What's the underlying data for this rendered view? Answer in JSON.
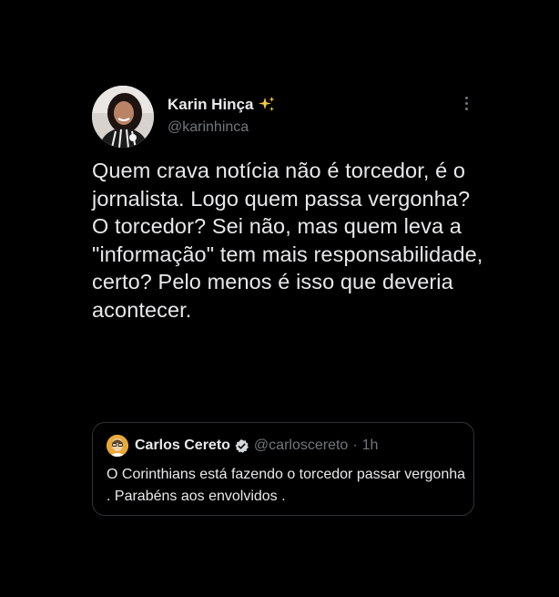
{
  "tweet": {
    "author": {
      "display_name": "Karin Hinça",
      "handle": "@karinhinca",
      "badge_emoji": "sparkles-icon"
    },
    "text": "Quem crava notícia não é torcedor, é o jornalista. Logo quem passa vergonha? O torcedor? Sei não, mas quem leva a \"informação\" tem mais responsabilidade, certo? Pelo menos é isso que deveria acontecer.",
    "menu_icon": "more-vertical-icon"
  },
  "quoted_tweet": {
    "author": {
      "display_name": "Carlos Cereto",
      "handle": "@carloscereto",
      "verified": true
    },
    "separator": "·",
    "time": "1h",
    "text": "O Corinthians está fazendo o torcedor passar vergonha . Parabéns aos envolvidos ."
  },
  "colors": {
    "background": "#000000",
    "primary_text": "#e7e9ea",
    "secondary_text": "#71767b",
    "border": "#2f3336",
    "verified": "#d4d4d4"
  }
}
